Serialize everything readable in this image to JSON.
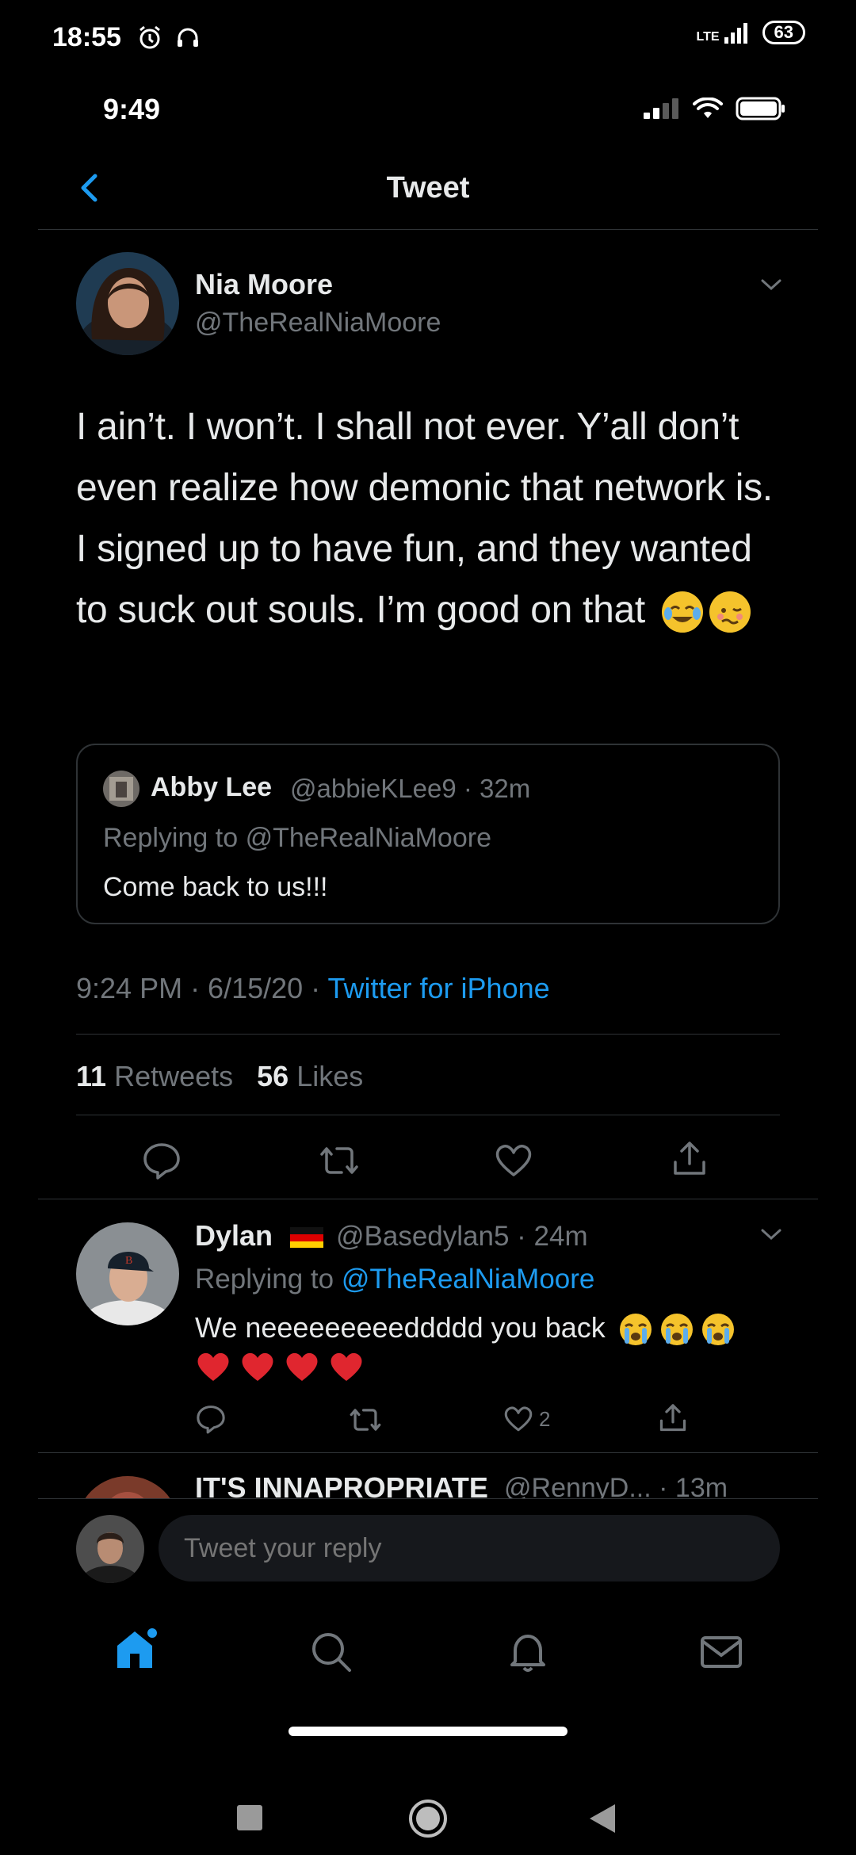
{
  "android_status": {
    "time": "18:55",
    "network": "LTE",
    "battery": "63"
  },
  "ios_status": {
    "time": "9:49"
  },
  "header": {
    "title": "Tweet"
  },
  "main_tweet": {
    "name": "Nia Moore",
    "handle": "@TheRealNiaMoore",
    "text": "I ain’t. I won’t. I shall not ever. Y’all don’t even realize how demonic that network is. I signed up to have fun, and they wanted to suck out souls. I’m good on that",
    "emojis": [
      "face-with-tears-of-joy",
      "woozy-face"
    ],
    "quote": {
      "name": "Abby Lee",
      "meta": "@abbieKLee9 · 32m",
      "replying_prefix": "Replying to",
      "replying_handle": "@TheRealNiaMoore",
      "text": "Come back to us!!!"
    },
    "timestamp": "9:24 PM · 6/15/20 · ",
    "source": "Twitter for iPhone",
    "retweets_count": "11",
    "retweets_label": " Retweets",
    "likes_count": "56",
    "likes_label": " Likes"
  },
  "replies": [
    {
      "name": "Dylan",
      "flag": "germany-flag",
      "meta": "@Basedylan5 · 24m",
      "replying_prefix": "Replying to ",
      "replying_handle": "@TheRealNiaMoore",
      "text": "We neeeeeeeeeddddd you back",
      "like_count": "2"
    },
    {
      "name": "IT'S INNAPROPRIATE",
      "meta": "@RennyD... · 13m"
    }
  ],
  "compose": {
    "placeholder": "Tweet your reply"
  },
  "colors": {
    "accent": "#1d9bf0",
    "background": "#000000",
    "muted": "#71767b",
    "text": "#e7e9ea",
    "divider": "#2f3336"
  }
}
